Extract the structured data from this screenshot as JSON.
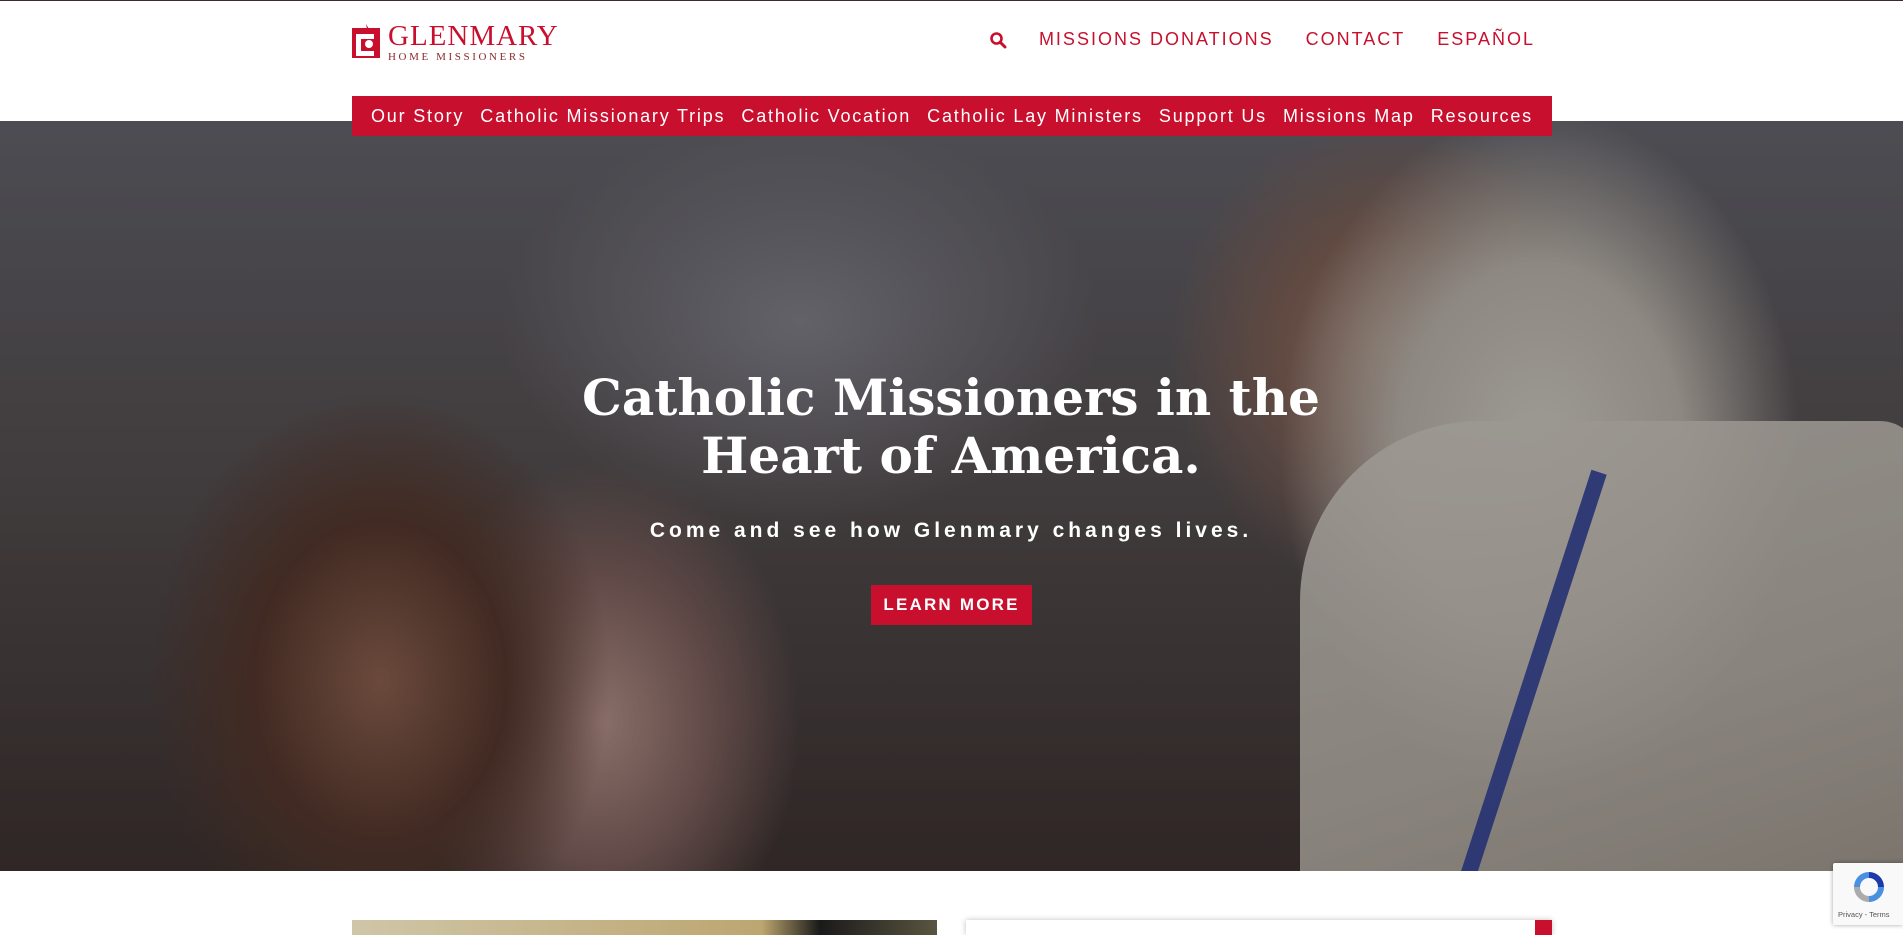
{
  "logo": {
    "name": "GLENMARY",
    "subtitle": "HOME MISSIONERS"
  },
  "util_nav": [
    "MISSIONS DONATIONS",
    "CONTACT",
    "ESPAÑOL"
  ],
  "main_nav": [
    "Our Story",
    "Catholic Missionary Trips",
    "Catholic Vocation",
    "Catholic Lay Ministers",
    "Support Us",
    "Missions Map",
    "Resources"
  ],
  "hero": {
    "title_line1": "Catholic Missioners in the",
    "title_line2": "Heart of America.",
    "subtitle": "Come and see how Glenmary changes lives.",
    "button": "LEARN MORE"
  },
  "recaptcha": {
    "label": "Privacy - Terms"
  },
  "colors": {
    "brand": "#c8102e",
    "white": "#ffffff"
  },
  "icons": [
    "logo-mark-icon",
    "search-icon",
    "recaptcha-icon"
  ]
}
